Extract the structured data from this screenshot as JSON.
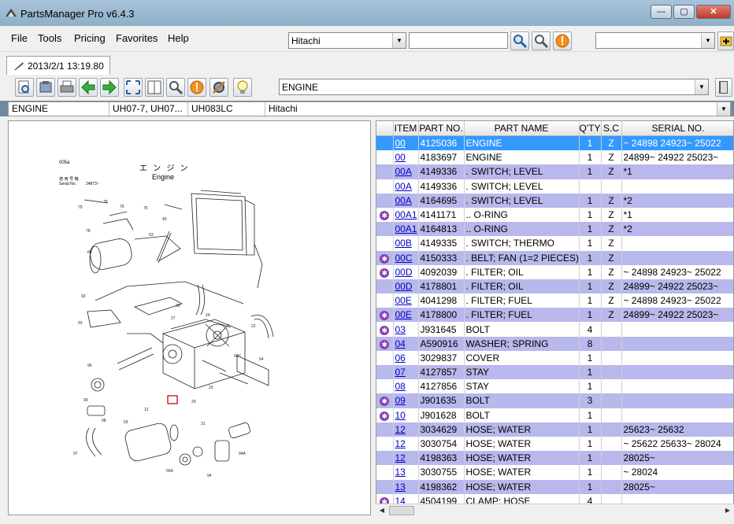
{
  "window": {
    "title": "PartsManager Pro v6.4.3",
    "minimize": "—",
    "maximize": "▢",
    "close": "✕"
  },
  "menu": [
    "File",
    "Tools",
    "Pricing",
    "Favorites",
    "Help"
  ],
  "search": {
    "maker_value": "Hitachi",
    "query_value": "",
    "right_combo_value": ""
  },
  "tab": {
    "label": "2013/2/1 13:19.80"
  },
  "toolbar": {
    "section_value": "ENGINE"
  },
  "info": {
    "section": "ENGINE",
    "models": "UH07-7, UH07...",
    "code": "UH083LC",
    "maker": "Hitachi"
  },
  "diagram": {
    "title_jp": "エ ン ジ ン",
    "title_en": "Engine",
    "serial_label_jp": "適 用 号 機",
    "serial_label": "Serial No.",
    "serial_value": "24873~",
    "page_code": "005a"
  },
  "grid": {
    "columns": [
      "ITEM",
      "PART NO.",
      "PART NAME",
      "Q'TY",
      "S.C",
      "SERIAL NO."
    ],
    "rows": [
      {
        "item": "00",
        "part": "4125036",
        "name": "ENGINE",
        "qty": "1",
        "sc": "Z",
        "serial": "~ 24898 24923~ 25022",
        "mark": "",
        "style": "sel"
      },
      {
        "item": "00",
        "part": "4183697",
        "name": "ENGINE",
        "qty": "1",
        "sc": "Z",
        "serial": "24899~ 24922 25023~",
        "mark": "",
        "style": ""
      },
      {
        "item": "00A",
        "part": "4149336",
        "name": ". SWITCH; LEVEL",
        "qty": "1",
        "sc": "Z",
        "serial": "*1",
        "mark": "",
        "style": "alt"
      },
      {
        "item": "00A",
        "part": "4149336",
        "name": ". SWITCH; LEVEL",
        "qty": "",
        "sc": "",
        "serial": "",
        "mark": "",
        "style": ""
      },
      {
        "item": "00A",
        "part": "4164695",
        "name": ". SWITCH; LEVEL",
        "qty": "1",
        "sc": "Z",
        "serial": "*2",
        "mark": "",
        "style": "alt"
      },
      {
        "item": "00A1",
        "part": "4141171",
        "name": ".. O-RING",
        "qty": "1",
        "sc": "Z",
        "serial": "*1",
        "mark": "gear",
        "style": ""
      },
      {
        "item": "00A1",
        "part": "4164813",
        "name": ".. O-RING",
        "qty": "1",
        "sc": "Z",
        "serial": "*2",
        "mark": "",
        "style": "alt"
      },
      {
        "item": "00B",
        "part": "4149335",
        "name": ". SWITCH; THERMO",
        "qty": "1",
        "sc": "Z",
        "serial": "",
        "mark": "",
        "style": ""
      },
      {
        "item": "00C",
        "part": "4150333",
        "name": ". BELT; FAN (1=2 PIECES)",
        "qty": "1",
        "sc": "Z",
        "serial": "",
        "mark": "gear",
        "style": "alt"
      },
      {
        "item": "00D",
        "part": "4092039",
        "name": ". FILTER; OIL",
        "qty": "1",
        "sc": "Z",
        "serial": "~ 24898 24923~ 25022",
        "mark": "gear",
        "style": ""
      },
      {
        "item": "00D",
        "part": "4178801",
        "name": ". FILTER; OIL",
        "qty": "1",
        "sc": "Z",
        "serial": "24899~ 24922 25023~",
        "mark": "",
        "style": "alt"
      },
      {
        "item": "00E",
        "part": "4041298",
        "name": ". FILTER; FUEL",
        "qty": "1",
        "sc": "Z",
        "serial": "~ 24898 24923~ 25022",
        "mark": "",
        "style": ""
      },
      {
        "item": "00E",
        "part": "4178800",
        "name": ". FILTER; FUEL",
        "qty": "1",
        "sc": "Z",
        "serial": "24899~ 24922 25023~",
        "mark": "gear",
        "style": "alt"
      },
      {
        "item": "03",
        "part": "J931645",
        "name": "BOLT",
        "qty": "4",
        "sc": "",
        "serial": "",
        "mark": "gear",
        "style": ""
      },
      {
        "item": "04",
        "part": "A590916",
        "name": "WASHER; SPRING",
        "qty": "8",
        "sc": "",
        "serial": "",
        "mark": "gear",
        "style": "alt"
      },
      {
        "item": "06",
        "part": "3029837",
        "name": "COVER",
        "qty": "1",
        "sc": "",
        "serial": "",
        "mark": "",
        "style": ""
      },
      {
        "item": "07",
        "part": "4127857",
        "name": "STAY",
        "qty": "1",
        "sc": "",
        "serial": "",
        "mark": "",
        "style": "alt"
      },
      {
        "item": "08",
        "part": "4127856",
        "name": "STAY",
        "qty": "1",
        "sc": "",
        "serial": "",
        "mark": "",
        "style": ""
      },
      {
        "item": "09",
        "part": "J901635",
        "name": "BOLT",
        "qty": "3",
        "sc": "",
        "serial": "",
        "mark": "gear",
        "style": "alt"
      },
      {
        "item": "10",
        "part": "J901628",
        "name": "BOLT",
        "qty": "1",
        "sc": "",
        "serial": "",
        "mark": "gear",
        "style": ""
      },
      {
        "item": "12",
        "part": "3034629",
        "name": "HOSE; WATER",
        "qty": "1",
        "sc": "",
        "serial": "25623~ 25632",
        "mark": "",
        "style": "alt"
      },
      {
        "item": "12",
        "part": "3030754",
        "name": "HOSE; WATER",
        "qty": "1",
        "sc": "",
        "serial": "~ 25622 25633~ 28024",
        "mark": "",
        "style": ""
      },
      {
        "item": "12",
        "part": "4198363",
        "name": "HOSE; WATER",
        "qty": "1",
        "sc": "",
        "serial": "28025~",
        "mark": "",
        "style": "alt"
      },
      {
        "item": "13",
        "part": "3030755",
        "name": "HOSE; WATER",
        "qty": "1",
        "sc": "",
        "serial": "~ 28024",
        "mark": "",
        "style": ""
      },
      {
        "item": "13",
        "part": "4198362",
        "name": "HOSE; WATER",
        "qty": "1",
        "sc": "",
        "serial": "28025~",
        "mark": "",
        "style": "alt"
      },
      {
        "item": "14",
        "part": "4504199",
        "name": "CLAMP; HOSE",
        "qty": "4",
        "sc": "",
        "serial": "",
        "mark": "gear",
        "style": ""
      }
    ]
  },
  "colors": {
    "selected": "#3399ff",
    "alt_row": "#b8b8ec",
    "link": "#0000cc",
    "gear": "#8a3fb0"
  }
}
